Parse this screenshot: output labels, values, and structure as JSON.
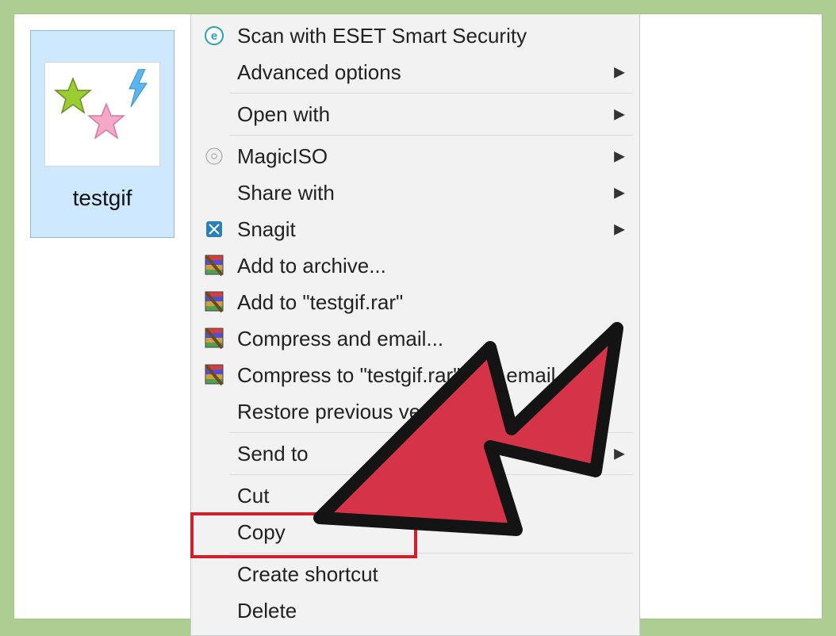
{
  "file": {
    "name": "testgif"
  },
  "menu": {
    "items": [
      {
        "label": "Scan with ESET Smart Security",
        "icon": "eset",
        "submenu": false
      },
      {
        "label": "Advanced options",
        "icon": "",
        "submenu": true
      },
      {
        "sep": true
      },
      {
        "label": "Open with",
        "icon": "",
        "submenu": true
      },
      {
        "sep": true
      },
      {
        "label": "MagicISO",
        "icon": "magiciso",
        "submenu": true
      },
      {
        "label": "Share with",
        "icon": "",
        "submenu": true
      },
      {
        "label": "Snagit",
        "icon": "snagit",
        "submenu": true
      },
      {
        "label": "Add to archive...",
        "icon": "winrar",
        "submenu": false
      },
      {
        "label": "Add to \"testgif.rar\"",
        "icon": "winrar",
        "submenu": false
      },
      {
        "label": "Compress and email...",
        "icon": "winrar",
        "submenu": false
      },
      {
        "label": "Compress to \"testgif.rar\" and email",
        "icon": "winrar",
        "submenu": false
      },
      {
        "label": "Restore previous versions",
        "icon": "",
        "submenu": false
      },
      {
        "sep": true
      },
      {
        "label": "Send to",
        "icon": "",
        "submenu": true
      },
      {
        "sep": true
      },
      {
        "label": "Cut",
        "icon": "",
        "submenu": false
      },
      {
        "label": "Copy",
        "icon": "",
        "submenu": false,
        "highlighted": true
      },
      {
        "sep": true
      },
      {
        "label": "Create shortcut",
        "icon": "",
        "submenu": false
      },
      {
        "label": "Delete",
        "icon": "",
        "submenu": false
      }
    ]
  },
  "annotation": {
    "pointer_target": "Copy"
  }
}
